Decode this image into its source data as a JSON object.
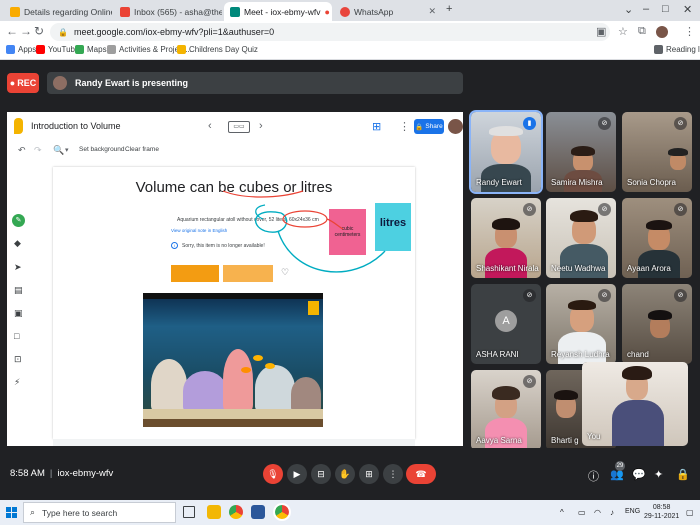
{
  "browser": {
    "tabs": [
      {
        "title": "Details regarding Online Session",
        "favicon_color": "#f9ab00"
      },
      {
        "title": "Inbox (565) - asha@theindiansc",
        "favicon_color": "#ea4335"
      },
      {
        "title": "Meet - iox-ebmy-wfv",
        "favicon_color": "#00897b"
      },
      {
        "title": "WhatsApp",
        "favicon_color": "#e8453c"
      }
    ],
    "url": "meet.google.com/iox-ebmy-wfv?pli=1&authuser=0",
    "bookmarks": [
      {
        "label": "Apps"
      },
      {
        "label": "YouTube"
      },
      {
        "label": "Maps"
      },
      {
        "label": "Activities & Project..."
      },
      {
        "label": "Childrens Day Quiz"
      }
    ],
    "reading_list": "Reading list"
  },
  "meet": {
    "rec_label": "REC",
    "presenting_text": "Randy Ewart is presenting",
    "time": "8:58 AM",
    "meeting_code": "iox-ebmy-wfv",
    "participant_count": "29"
  },
  "presentation": {
    "doc_title": "Introduction to Volume",
    "share_label": "Share",
    "set_background": "Set background",
    "clear_frame": "Clear frame",
    "slide": {
      "title": "Volume can be cubes or litres",
      "aquarium_text": "Aquarium rectangular atoll without cover, 52 liters, 60x24x36 cm",
      "view_original": "View original note in English",
      "unavailable": "Sorry, this item is no longer available!",
      "cubic_label": "cubic centimeters",
      "litres_label": "litres"
    }
  },
  "participants": [
    {
      "name": "Randy Ewart",
      "mic": "active"
    },
    {
      "name": "Samira Mishra",
      "mic": "muted"
    },
    {
      "name": "Sonia Chopra",
      "mic": "muted"
    },
    {
      "name": "Shashikant Nirala",
      "mic": "muted"
    },
    {
      "name": "Neetu Wadhwa",
      "mic": "muted"
    },
    {
      "name": "Ayaan Arora",
      "mic": "muted"
    },
    {
      "name": "ASHA RANI",
      "initial": "A",
      "mic": "muted"
    },
    {
      "name": "Reyansh Ludhra",
      "mic": "muted"
    },
    {
      "name": "chand",
      "mic": "muted"
    },
    {
      "name": "Aavya Sarna",
      "mic": "muted"
    },
    {
      "name": "Bharti g",
      "mic": "muted"
    },
    {
      "name": "You",
      "mic": "none"
    }
  ],
  "taskbar": {
    "search_placeholder": "Type here to search",
    "language": "ENG",
    "time": "08:58",
    "date": "29-11-2021"
  },
  "colors": {
    "meet_bg": "#202124",
    "accent_blue": "#1a73e8",
    "rec_red": "#ea4335",
    "speaking_outline": "#8ab4f8"
  }
}
